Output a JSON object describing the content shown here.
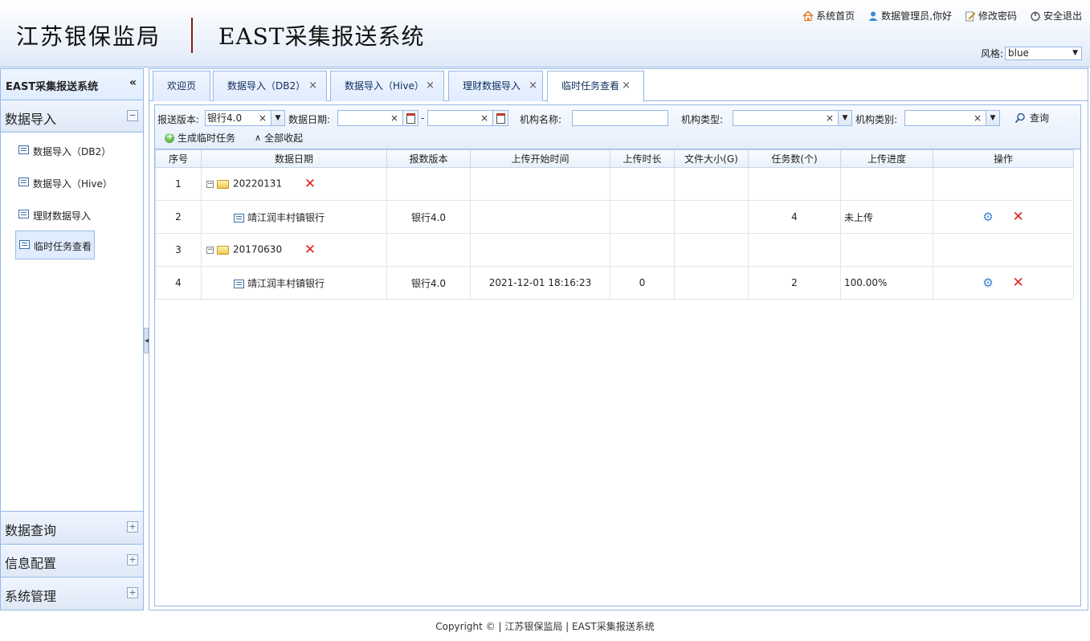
{
  "header": {
    "org_name": "江苏银保监局",
    "system_name": "EAST采集报送系统",
    "links": {
      "home": "系统首页",
      "user": "数据管理员,你好",
      "password": "修改密码",
      "logout": "安全退出"
    },
    "theme_label": "风格:",
    "theme_value": "blue"
  },
  "sidebar": {
    "title": "EAST采集报送系统",
    "collapse_glyph": "«",
    "groups": [
      {
        "label": "数据导入",
        "expanded": true,
        "toggle": "−",
        "items": [
          {
            "label": "数据导入（DB2）"
          },
          {
            "label": "数据导入（Hive）"
          },
          {
            "label": "理财数据导入"
          },
          {
            "label": "临时任务查看"
          }
        ]
      },
      {
        "label": "数据查询",
        "toggle": "+"
      },
      {
        "label": "信息配置",
        "toggle": "+"
      },
      {
        "label": "系统管理",
        "toggle": "+"
      }
    ]
  },
  "tabs": [
    {
      "label": "欢迎页",
      "closable": false
    },
    {
      "label": "数据导入（DB2）",
      "closable": true
    },
    {
      "label": "数据导入（Hive）",
      "closable": true
    },
    {
      "label": "理财数据导入",
      "closable": true
    },
    {
      "label": "临时任务查看",
      "closable": true,
      "active": true
    }
  ],
  "toolbar": {
    "version_label": "报送版本:",
    "version_value": "银行4.0",
    "date_label": "数据日期:",
    "date_sep": "-",
    "org_name_label": "机构名称:",
    "org_type_label": "机构类型:",
    "org_category_label": "机构类别:",
    "search_label": "查询",
    "generate_label": "生成临时任务",
    "collapse_all_label": "全部收起"
  },
  "grid": {
    "columns": [
      "序号",
      "数据日期",
      "报数版本",
      "上传开始时间",
      "上传时长",
      "文件大小(G)",
      "任务数(个)",
      "上传进度",
      "操作"
    ],
    "rows": [
      {
        "seq": "1",
        "date": "20220131",
        "type": "group"
      },
      {
        "seq": "2",
        "name": "靖江润丰村镇银行",
        "version": "银行4.0",
        "start": "",
        "duration": "",
        "size": "",
        "tasks": "4",
        "progress": "未上传"
      },
      {
        "seq": "3",
        "date": "20170630",
        "type": "group"
      },
      {
        "seq": "4",
        "name": "靖江润丰村镇银行",
        "version": "银行4.0",
        "start": "2021-12-01 18:16:23",
        "duration": "0",
        "size": "",
        "tasks": "2",
        "progress": "100.00%"
      }
    ]
  },
  "footer": "Copyright © | 江苏银保监局 | EAST采集报送系统",
  "colors": {
    "border": "#95b8e7",
    "header_bg": "#eaf1fb",
    "delete": "#e02020",
    "gear": "#3f7fd1"
  }
}
